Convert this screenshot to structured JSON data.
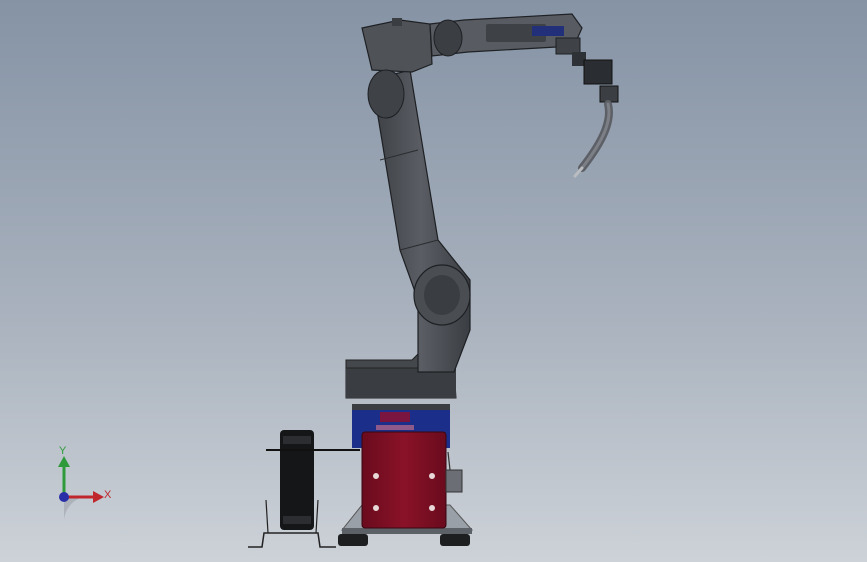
{
  "viewport": {
    "background_top": "#8593a5",
    "background_bottom": "#cdd2d8"
  },
  "triad": {
    "x_label": "X",
    "y_label": "Y",
    "x_color": "#c0262d",
    "y_color": "#2e9a3a",
    "z_color": "#2a2fa8"
  },
  "model": {
    "arm_color": "#4e5257",
    "base_color": "#3a3d42",
    "ring_color": "#1b2f8a",
    "cabinet_color": "#7a0d22",
    "torch_color": "#5c6066"
  }
}
